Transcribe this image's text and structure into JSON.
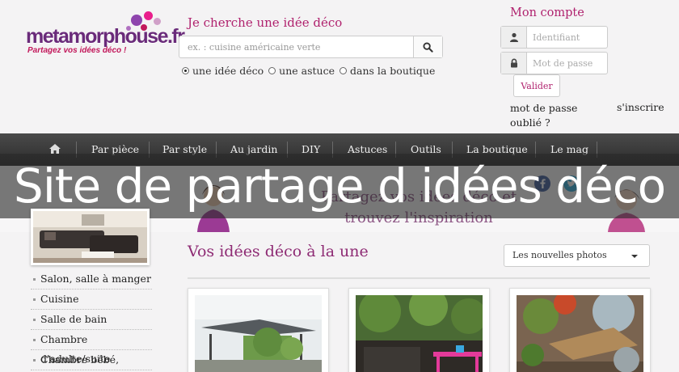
{
  "logo": {
    "name": "metamorphouse.fr",
    "tagline": "Partagez vos idées déco !"
  },
  "search": {
    "title": "Je cherche une idée déco",
    "placeholder": "ex. : cuisine américaine verte",
    "options": [
      "une idée déco",
      "une astuce",
      "dans la boutique"
    ],
    "selected_option": "une idée déco"
  },
  "account": {
    "title": "Mon compte",
    "username_placeholder": "Identifiant",
    "password_placeholder": "Mot de passe",
    "validate_label": "Valider",
    "forgot_label": "mot de passe oublié ?",
    "signup_label": "s'inscrire"
  },
  "nav": {
    "home_icon": "home-icon",
    "items": [
      "Par pièce",
      "Par style",
      "Au jardin",
      "DIY",
      "Astuces",
      "Outils",
      "La boutique",
      "Le mag"
    ]
  },
  "hero": {
    "text": "Partagez vos idées déco et trouvez l'inspiration"
  },
  "overlay": {
    "title": "Site de partage d idées déco"
  },
  "sidebar": {
    "items": [
      "Salon, salle à manger",
      "Cuisine",
      "Salle de bain",
      "Chambre d'adulte/suite",
      "Chambre bébé, enfant"
    ]
  },
  "main": {
    "title": "Vos idées déco à la une",
    "sort_value": "Les nouvelles photos"
  },
  "colors": {
    "brand_pink": "#b0226e",
    "brand_purple": "#6a2b7a",
    "nav_bg": "#333333"
  }
}
